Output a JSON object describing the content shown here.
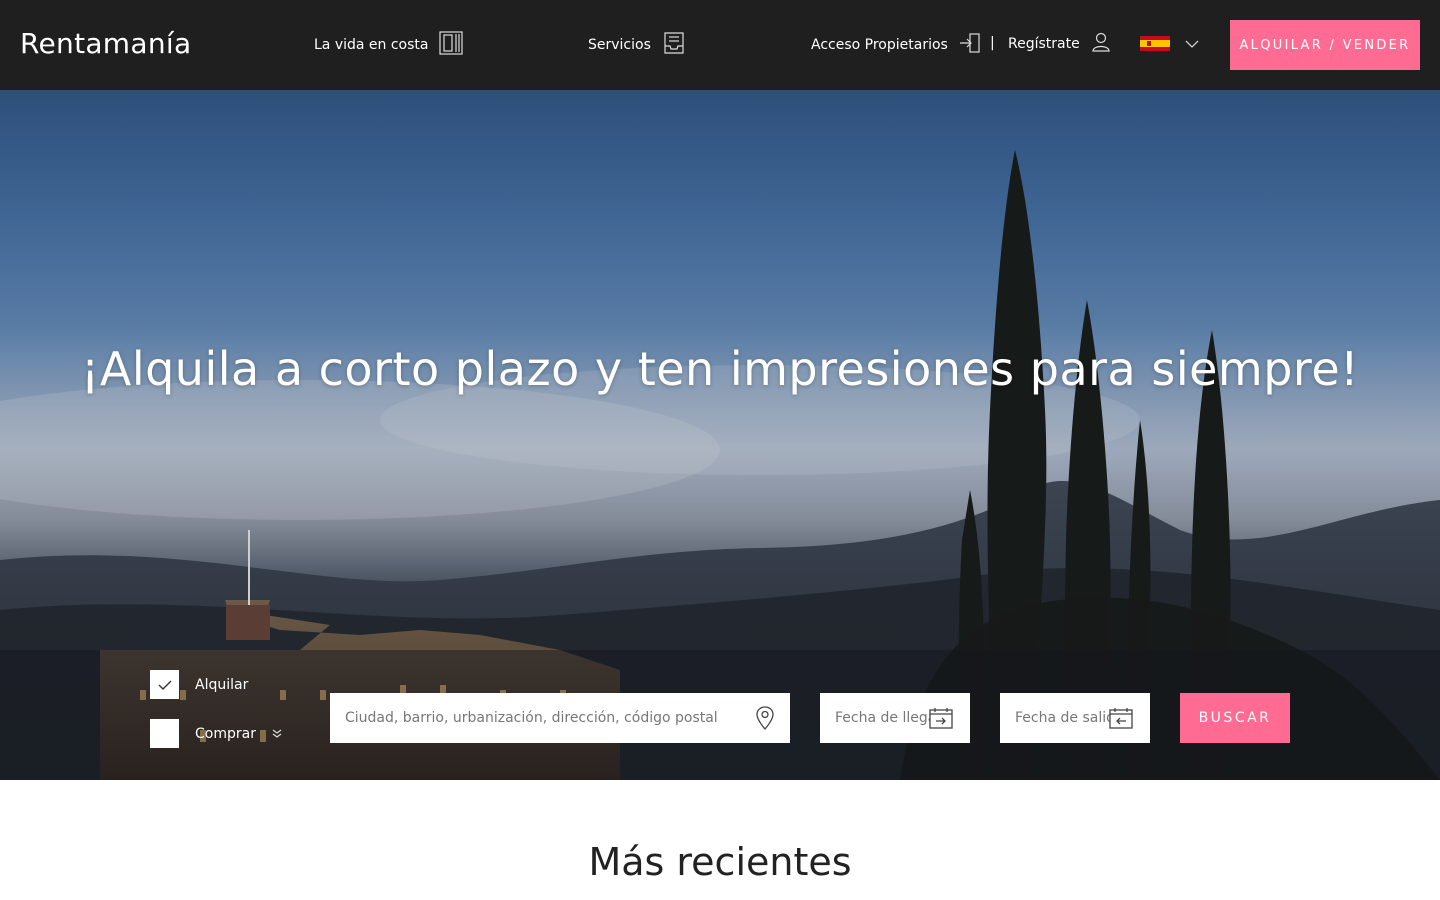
{
  "header": {
    "logo": "Rentamanía",
    "nav": {
      "vida_label": "La vida en costa",
      "vida_icon": "building-icon",
      "servicios_label": "Servicios",
      "servicios_icon": "inbox-tray-icon",
      "owners_label": "Acceso Propietarios",
      "owners_icon": "login-door-icon",
      "separator": "|",
      "register_label": "Regístrate",
      "register_icon": "user-icon"
    },
    "language": {
      "flag": "spain-flag",
      "icon": "chevron-down-icon"
    },
    "cta_label": "ALQUILAR / VENDER"
  },
  "hero": {
    "headline": "¡Alquila a corto plazo y ten impresiones para siempre!",
    "search": {
      "options": [
        {
          "label": "Alquilar",
          "checked": true
        },
        {
          "label": "Comprar",
          "checked": false
        }
      ],
      "location_placeholder": "Ciudad, barrio, urbanización, dirección, código postal",
      "location_icon": "map-pin-icon",
      "checkin_placeholder": "Fecha de llegada",
      "checkin_icon": "calendar-arrow-in-icon",
      "checkout_placeholder": "Fecha de salida",
      "checkout_icon": "calendar-arrow-out-icon",
      "button_label": "BUSCAR"
    }
  },
  "recent": {
    "title": "Más recientes"
  },
  "colors": {
    "header_bg": "#1f1f1f",
    "accent": "#ff6b92",
    "text_dark": "#222222"
  }
}
